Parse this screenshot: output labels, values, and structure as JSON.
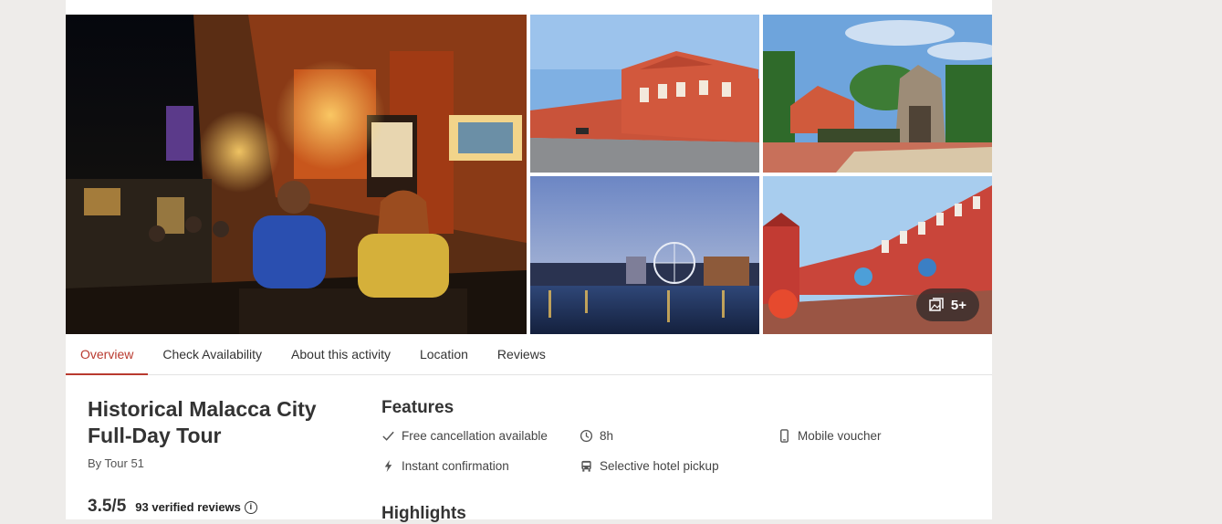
{
  "gallery": {
    "more_label": "5+",
    "photos": [
      {
        "name": "night-street-photo"
      },
      {
        "name": "red-buildings-photo"
      },
      {
        "name": "fort-ruins-photo"
      },
      {
        "name": "river-ferris-wheel-photo"
      },
      {
        "name": "red-square-photo"
      }
    ]
  },
  "tabs": [
    {
      "label": "Overview",
      "active": true
    },
    {
      "label": "Check Availability"
    },
    {
      "label": "About this activity"
    },
    {
      "label": "Location"
    },
    {
      "label": "Reviews"
    }
  ],
  "activity": {
    "title_line1": "Historical Malacca City",
    "title_line2": "Full-Day Tour",
    "by": "By Tour 51",
    "rating": "3.5/5",
    "reviews": "93 verified reviews"
  },
  "features": {
    "title": "Features",
    "items": [
      {
        "label": "Free cancellation available",
        "icon": "checkmark-icon"
      },
      {
        "label": "8h",
        "icon": "clock-icon"
      },
      {
        "label": "Mobile voucher",
        "icon": "mobile-icon"
      },
      {
        "label": "Instant confirmation",
        "icon": "lightning-icon"
      },
      {
        "label": "Selective hotel pickup",
        "icon": "bus-icon"
      }
    ]
  },
  "highlights": {
    "title": "Highlights"
  },
  "colors": {
    "accent": "#b93a2f",
    "page_bg": "#eeecea"
  }
}
